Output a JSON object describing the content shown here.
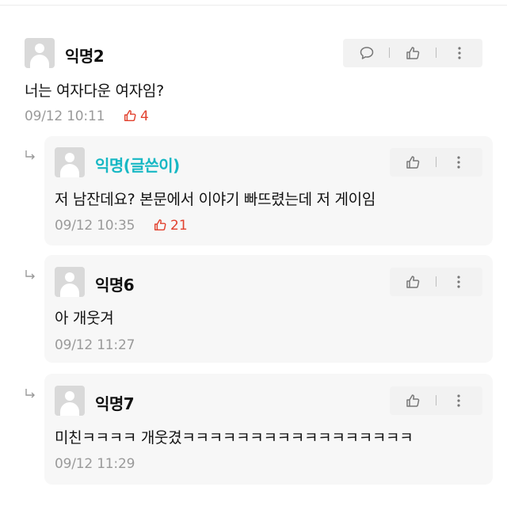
{
  "comments": [
    {
      "author": "익명2",
      "text": "너는 여자다운 여자임?",
      "time": "09/12 10:11",
      "votes": "4",
      "icons": [
        "comment-icon",
        "thumbs-up-icon",
        "more-icon"
      ]
    },
    {
      "author": "익명(글쓴이)",
      "text": "저 남잔데요? 본문에서 이야기 빠뜨렸는데 저 게이임",
      "time": "09/12 10:35",
      "votes": "21",
      "icons": [
        "thumbs-up-icon",
        "more-icon"
      ]
    },
    {
      "author": "익명6",
      "text": "아 개웃겨",
      "time": "09/12 11:27",
      "icons": [
        "thumbs-up-icon",
        "more-icon"
      ]
    },
    {
      "author": "익명7",
      "text": "미친ㅋㅋㅋㅋ 개웃겼ㅋㅋㅋㅋㅋㅋㅋㅋㅋㅋㅋㅋㅋㅋㅋㅋㅋ",
      "time": "09/12 11:29",
      "icons": [
        "thumbs-up-icon",
        "more-icon"
      ]
    }
  ],
  "colors": {
    "op_author": "#17b8c4",
    "vote": "#e2412e",
    "meta": "#9a9a9a",
    "reply_bg": "#f7f7f7"
  }
}
